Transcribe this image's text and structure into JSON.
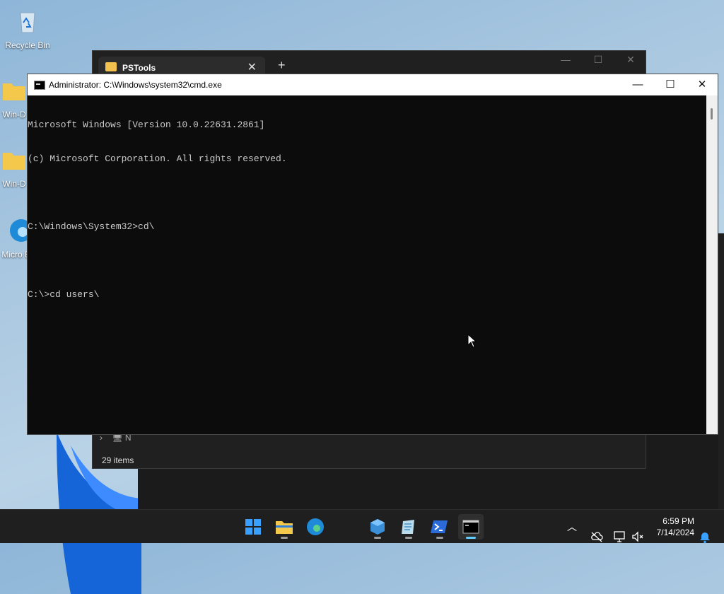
{
  "desktop": {
    "icons": [
      {
        "label": "Recycle Bin"
      },
      {
        "label": "Win-D"
      },
      {
        "label": "Win-D"
      },
      {
        "label": "Micro Ed"
      }
    ]
  },
  "explorer": {
    "tab_title": "PSTools",
    "nav_item": "N",
    "status_text": "29 items"
  },
  "cmd": {
    "title": "Administrator: C:\\Windows\\system32\\cmd.exe",
    "lines": [
      "Microsoft Windows [Version 10.0.22631.2861]",
      "(c) Microsoft Corporation. All rights reserved.",
      "",
      "C:\\Windows\\System32>cd\\",
      "",
      "C:\\>cd users\\"
    ]
  },
  "taskbar": {
    "time": "6:59 PM",
    "date": "7/14/2024"
  },
  "colors": {
    "accent": "#60cdff",
    "console_bg": "#0c0c0c",
    "console_fg": "#cccccc",
    "taskbar_bg": "#1f1f1f"
  }
}
